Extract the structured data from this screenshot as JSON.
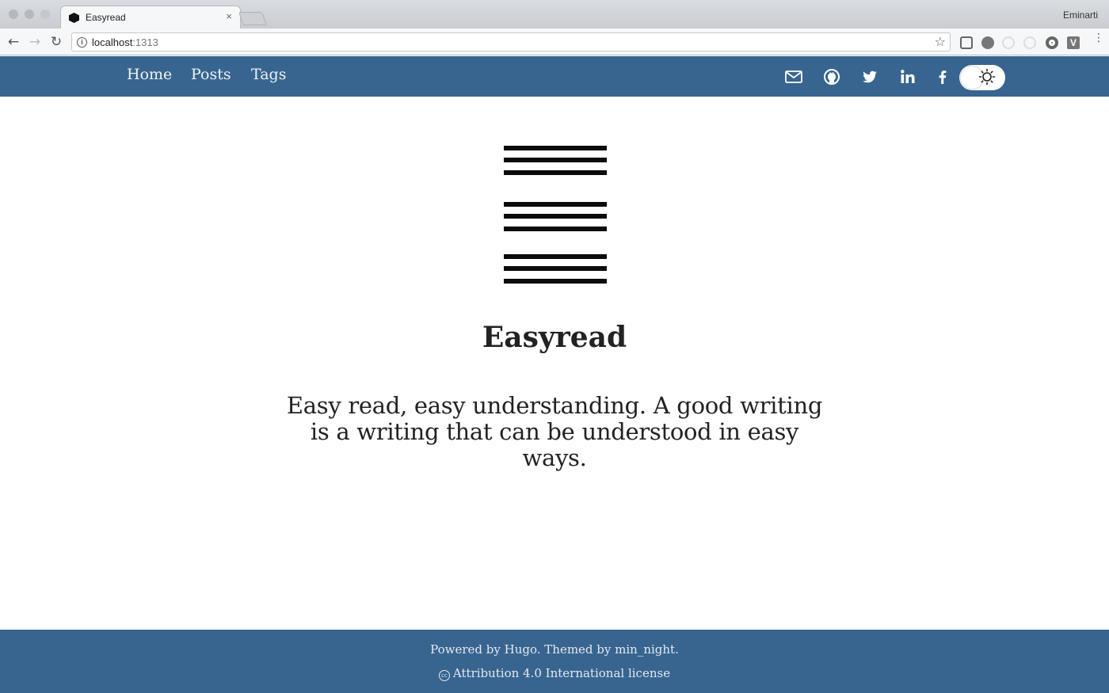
{
  "browser": {
    "tab_title": "Easyread",
    "tab_close": "×",
    "profile_name": "Eminarti",
    "url_host": "localhost",
    "url_port": ":1313",
    "extension_label": "V"
  },
  "nav": {
    "links": [
      {
        "label": "Home"
      },
      {
        "label": "Posts"
      },
      {
        "label": "Tags"
      }
    ],
    "social_icons": [
      "mail-icon",
      "github-icon",
      "twitter-icon",
      "linkedin-icon",
      "facebook-icon"
    ],
    "theme_toggle_icon": "sun-icon"
  },
  "main": {
    "title": "Easyread",
    "tagline": "Easy read, easy understanding. A good writing is a writing that can be understood in easy ways."
  },
  "footer": {
    "credit": "Powered by Hugo. Themed by min_night.",
    "license_icon": "cc",
    "license": "Attribution 4.0 International license"
  },
  "colors": {
    "header_bg": "#376590",
    "footer_bg": "#376590",
    "text": "#222222",
    "logo": "#0b0b0b"
  }
}
